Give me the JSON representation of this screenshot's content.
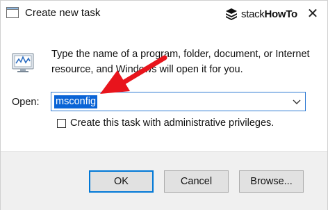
{
  "window": {
    "title": "Create new task",
    "close_glyph": "✕"
  },
  "brand": {
    "prefix": "stack",
    "suffix": "HowTo",
    "icon": "stack-logo-icon"
  },
  "content": {
    "description": "Type the name of a program, folder, document, or Internet resource, and Windows will open it for you.",
    "run_icon": "run-dialog-icon"
  },
  "open_field": {
    "label": "Open:",
    "value": "msconfig",
    "dropdown_icon": "chevron-down-icon"
  },
  "admin_option": {
    "label": "Create this task with administrative privileges.",
    "checked": false
  },
  "buttons": {
    "ok": "OK",
    "cancel": "Cancel",
    "browse": "Browse..."
  },
  "annotation": {
    "arrow_color": "#e8141c"
  },
  "colors": {
    "accent": "#0078d7",
    "selection": "#0a64d6"
  }
}
